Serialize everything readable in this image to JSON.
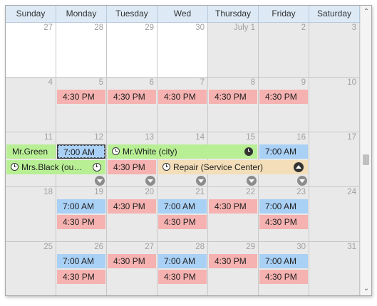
{
  "days": [
    "Sunday",
    "Monday",
    "Tuesday",
    "Wed",
    "Thursday",
    "Friday",
    "Saturday"
  ],
  "weeks": [
    [
      "27",
      "28",
      "29",
      "30",
      "July 1",
      "2",
      "3"
    ],
    [
      "4",
      "5",
      "6",
      "7",
      "8",
      "9",
      "10"
    ],
    [
      "11",
      "12",
      "13",
      "14",
      "15",
      "16",
      "17"
    ],
    [
      "18",
      "19",
      "20",
      "21",
      "22",
      "23",
      "24"
    ],
    [
      "25",
      "26",
      "27",
      "28",
      "29",
      "30",
      "31"
    ]
  ],
  "labels": {
    "t700": "7:00 AM",
    "t430": "4:30 PM",
    "mrgreen": "Mr.Green",
    "mrwhite": "Mr.White (city)",
    "mrsblack": "Mrs.Black (ou…",
    "repair": "Repair (Service Center)"
  },
  "colors": {
    "pink": "#f5b2b0",
    "blue": "#a9d0f5",
    "green": "#b8ef95",
    "tan": "#f3deb9",
    "header": "#ddeaf6",
    "weekend": "#e9e9e9"
  }
}
